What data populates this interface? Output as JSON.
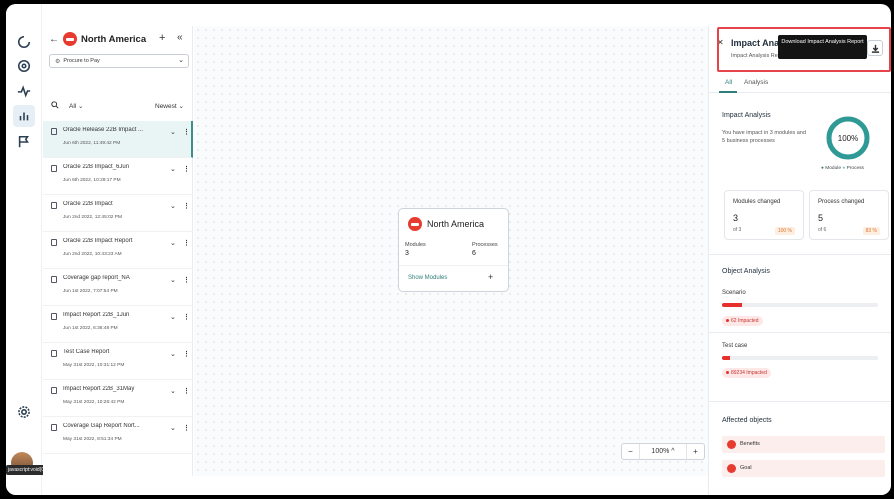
{
  "app": {
    "user_tag": "javascript:void(0)"
  },
  "list_panel": {
    "title": "North America",
    "dropdown_value": "Procure to Pay",
    "filter_all": "All",
    "sort_label": "Newest",
    "reports": [
      {
        "name": "Oracle Release 22B Impact ...",
        "date": "Jun 6th 2022, 11:49:42 PM",
        "selected": true
      },
      {
        "name": "Oracle 22B Impact_6Jun",
        "date": "Jun 6th 2022, 10:29:17 PM"
      },
      {
        "name": "Oracle 22B Impact",
        "date": "Jun 2nd 2022, 12:45:02 PM"
      },
      {
        "name": "Oracle 22B Impact Report",
        "date": "Jun 2nd 2022, 10:43:23 AM"
      },
      {
        "name": "Coverage gap report_NA",
        "date": "Jun 1st 2022, 7:07:54 PM"
      },
      {
        "name": "Impact Report 22B_1Jun",
        "date": "Jun 1st 2022, 6:36:48 PM"
      },
      {
        "name": "Test Case Report",
        "date": "May 31st 2022, 10:31:12 PM"
      },
      {
        "name": "Impact Report 22B_31May",
        "date": "May 31st 2022, 10:26:42 PM"
      },
      {
        "name": "Coverage Gap Report Nort...",
        "date": "May 31st 2022, 8:51:34 PM"
      }
    ]
  },
  "canvas": {
    "node": {
      "title": "North America",
      "modules_label": "Modules",
      "modules_value": "3",
      "processes_label": "Processes",
      "processes_value": "6",
      "show_modules": "Show Modules"
    },
    "zoom": {
      "minus": "−",
      "value": "100%",
      "chevron": "^",
      "plus": "+"
    }
  },
  "right_panel": {
    "title": "Impact Analysis",
    "subtitle": "Impact Analysis Report",
    "tooltip": "Download Impact Analysis Report",
    "tabs": [
      "All",
      "Analysis"
    ],
    "impact_title": "Impact Analysis",
    "impact_desc": "You have impact in 3 modules and 5 business processes",
    "donut_value": "100%",
    "donut_fraction": 1.0,
    "legend_module": "Module",
    "legend_process": "Process",
    "modules_card": {
      "label": "Modules changed",
      "value": "3",
      "of": "of 3",
      "pct": "100 %"
    },
    "process_card": {
      "label": "Process changed",
      "value": "5",
      "of": "of 6",
      "pct": "83 %"
    },
    "object_title": "Object Analysis",
    "scenario": {
      "label": "Scenario",
      "badge": "62 Impacted",
      "fill_pct": 13
    },
    "testcase": {
      "label": "Test case",
      "badge": "89234 Impacted",
      "fill_pct": 5
    },
    "affected_title": "Affected objects",
    "affected": [
      "Benefits",
      "Goal"
    ],
    "colors": {
      "accent": "#2f7f7a",
      "danger": "#e5302c",
      "highlight": "#e5444a"
    }
  }
}
